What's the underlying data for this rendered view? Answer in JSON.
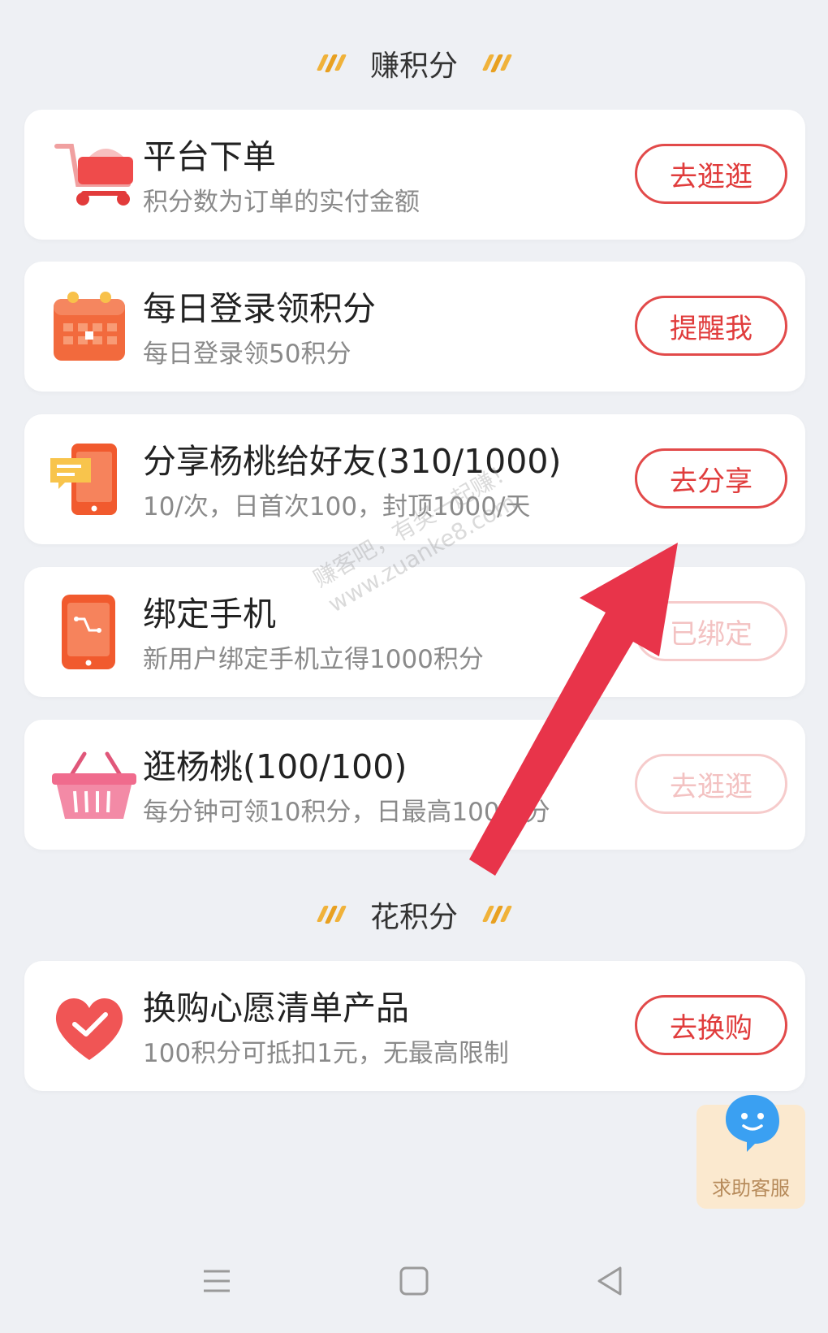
{
  "sections": {
    "earn_title": "赚积分",
    "spend_title": "花积分"
  },
  "tasks": [
    {
      "title": "平台下单",
      "subtitle": "积分数为订单的实付金额",
      "button": "去逛逛",
      "icon": "shopping-cart-icon",
      "enabled": true
    },
    {
      "title": "每日登录领积分",
      "subtitle": "每日登录领50积分",
      "button": "提醒我",
      "icon": "calendar-icon",
      "enabled": true
    },
    {
      "title": "分享杨桃给好友(310/1000)",
      "subtitle": "10/次，日首次100，封顶1000/天",
      "button": "去分享",
      "icon": "share-chat-icon",
      "enabled": true
    },
    {
      "title": "绑定手机",
      "subtitle": "新用户绑定手机立得1000积分",
      "button": "已绑定",
      "icon": "phone-icon",
      "enabled": false
    },
    {
      "title": "逛杨桃(100/100)",
      "subtitle": "每分钟可领10积分，日最高100积分",
      "button": "去逛逛",
      "icon": "basket-icon",
      "enabled": false
    }
  ],
  "spend": [
    {
      "title": "换购心愿清单产品",
      "subtitle": "100积分可抵扣1元，无最高限制",
      "button": "去换购",
      "icon": "heart-check-icon",
      "enabled": true
    }
  ],
  "help": {
    "label": "求助客服",
    "icon": "customer-service-icon"
  },
  "watermark": {
    "line1": "赚客吧，有奖一起赚！",
    "line2": "www.zuanke8.com"
  },
  "colors": {
    "accent": "#e03c3c",
    "background": "#eef0f4",
    "slash": "#f0b23a"
  }
}
